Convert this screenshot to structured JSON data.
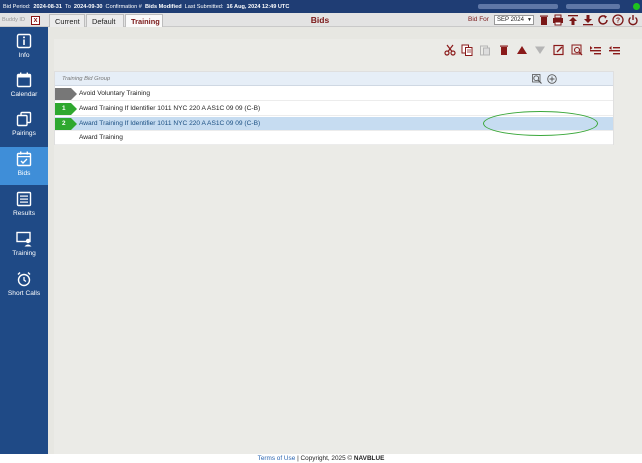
{
  "topbar": {
    "bid_period_label": "Bid Period:",
    "bid_period_start": "2024-08-31",
    "to_label": "To",
    "bid_period_end": "2024-09-30",
    "confirmation_label": "Confirmation #",
    "status": "Bids Modified",
    "last_submitted_label": "Last Submitted:",
    "last_submitted": "16 Aug, 2024 12:49 UTC"
  },
  "tabbar": {
    "buddy_label": "Buddy ID",
    "buddy_clear": "x",
    "tabs": [
      "Current",
      "Default",
      "Training"
    ],
    "active_tab": "Training",
    "title": "Bids",
    "bid_for_label": "Bid For",
    "bid_for_value": "SEP 2024"
  },
  "sidebar": {
    "items": [
      {
        "label": "Info",
        "icon": "info-icon"
      },
      {
        "label": "Calendar",
        "icon": "calendar-icon"
      },
      {
        "label": "Pairings",
        "icon": "pairings-icon"
      },
      {
        "label": "Bids",
        "icon": "bids-icon"
      },
      {
        "label": "Results",
        "icon": "results-icon"
      },
      {
        "label": "Training",
        "icon": "training-icon"
      },
      {
        "label": "Short Calls",
        "icon": "alarm-clock-icon"
      }
    ],
    "active": "Bids"
  },
  "toolbar": {
    "icons": [
      "cut-icon",
      "copy-icon",
      "paste-icon",
      "delete-icon",
      "move-up-icon",
      "move-down-icon",
      "edit-icon",
      "search-edit-icon",
      "indent-icon",
      "outdent-icon"
    ]
  },
  "bid_group": {
    "header": "Training Bid Group",
    "rows": [
      {
        "number": "",
        "label": "Avoid Voluntary Training",
        "marker_color": "#777777",
        "selected": false
      },
      {
        "number": "1",
        "label": "Award Training If Identifier 1011 NYC 220 A AS1C 09 09 (C-B)",
        "marker_color": "#2fa82f",
        "selected": false
      },
      {
        "number": "2",
        "label": "Award Training If Identifier 1011 NYC 220 A AS1C 09 09 (C-B)",
        "marker_color": "#2fa82f",
        "selected": true
      },
      {
        "number": "",
        "label": "Award Training",
        "marker_color": "",
        "selected": false
      }
    ]
  },
  "annotation": {
    "color": "#3aa73a"
  },
  "footer": {
    "terms_link": "Terms of Use",
    "separator": "|",
    "copyright": "Copyright, 2025 ©",
    "brand": "NAVBLUE"
  },
  "colors": {
    "topbar": "#1f3d74",
    "sidebar": "#1f4a86",
    "sidebar_active": "#3f8ed8",
    "accent": "#7a1717",
    "selected_row": "#c6dcf1"
  }
}
